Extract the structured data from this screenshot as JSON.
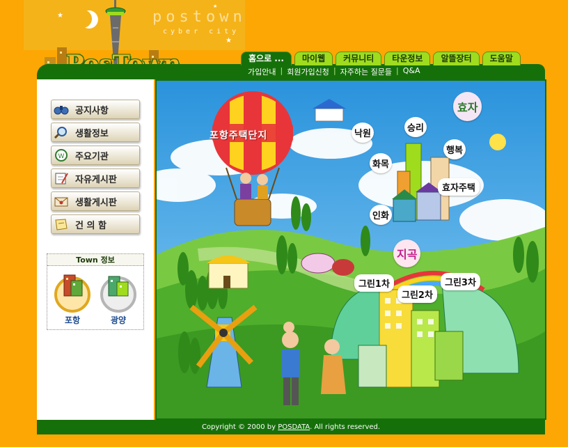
{
  "header": {
    "logo_text": "postown",
    "logo_sub": "cyber city",
    "brand": "PosTown"
  },
  "nav": {
    "tabs": [
      {
        "label": "홈으로 ...",
        "active": true
      },
      {
        "label": "마이웹",
        "active": false
      },
      {
        "label": "커뮤니티",
        "active": false
      },
      {
        "label": "타운정보",
        "active": false
      },
      {
        "label": "알뜰장터",
        "active": false
      },
      {
        "label": "도움말",
        "active": false
      }
    ],
    "subnav": [
      "가입안내",
      "회원가입신청",
      "자주하는 질문들",
      "Q&A"
    ]
  },
  "sidebar": {
    "menu": [
      {
        "label": "공지사항",
        "icon": "binoculars-icon"
      },
      {
        "label": "생활정보",
        "icon": "magnifier-icon"
      },
      {
        "label": "주요기관",
        "icon": "compass-icon"
      },
      {
        "label": "자유게시판",
        "icon": "notepad-icon"
      },
      {
        "label": "생활게시판",
        "icon": "envelope-icon"
      },
      {
        "label": "건 의 함",
        "icon": "memo-icon"
      }
    ],
    "town": {
      "title": "Town 정보",
      "items": [
        {
          "label": "포항",
          "icon": "town-pohang-icon"
        },
        {
          "label": "광양",
          "icon": "town-gwangyang-icon"
        }
      ]
    }
  },
  "scene": {
    "balloon_text": "포항주택단지",
    "labels": {
      "hyoja": "효자",
      "jigok": "지곡",
      "nakwon": "낙원",
      "seungni": "승리",
      "haengbok": "행복",
      "hwamok": "화목",
      "hyoja_jutaek": "효자주택",
      "inhwa": "인화",
      "green1": "그린1차",
      "green2": "그린2차",
      "green3": "그린3차"
    }
  },
  "footer": {
    "prefix": "Copyright © 2000 by",
    "company": "POSDATA",
    "suffix": ". All rights reserved."
  }
}
